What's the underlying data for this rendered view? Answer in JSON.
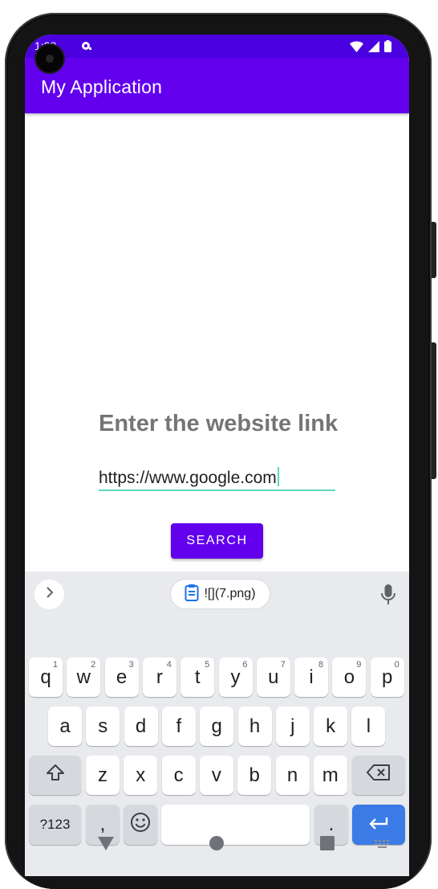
{
  "status_bar": {
    "time": "1:38"
  },
  "app_bar": {
    "title": "My Application"
  },
  "main": {
    "heading": "Enter the website link",
    "url_input_value": "https://www.google.com",
    "search_button_label": "SEARCH"
  },
  "keyboard": {
    "clipboard_chip": "![](7.png)",
    "row1": [
      {
        "key": "q",
        "hint": "1"
      },
      {
        "key": "w",
        "hint": "2"
      },
      {
        "key": "e",
        "hint": "3"
      },
      {
        "key": "r",
        "hint": "4"
      },
      {
        "key": "t",
        "hint": "5"
      },
      {
        "key": "y",
        "hint": "6"
      },
      {
        "key": "u",
        "hint": "7"
      },
      {
        "key": "i",
        "hint": "8"
      },
      {
        "key": "o",
        "hint": "9"
      },
      {
        "key": "p",
        "hint": "0"
      }
    ],
    "row2": [
      "a",
      "s",
      "d",
      "f",
      "g",
      "h",
      "j",
      "k",
      "l"
    ],
    "row3": [
      "z",
      "x",
      "c",
      "v",
      "b",
      "n",
      "m"
    ],
    "symbols_key": "?123",
    "comma_key": ",",
    "period_key": "."
  },
  "colors": {
    "status_bar": "#4b00e0",
    "app_bar": "#6200ee",
    "accent": "#5fd6c0",
    "enter_key": "#3b7be6"
  },
  "icons": {
    "status": [
      "notification-icon",
      "wifi-icon",
      "signal-icon",
      "battery-icon"
    ],
    "keyboard": [
      "chevron-right-icon",
      "clipboard-icon",
      "mic-icon",
      "shift-icon",
      "backspace-icon",
      "emoji-icon",
      "enter-icon"
    ],
    "nav": [
      "back-icon",
      "home-icon",
      "recents-icon",
      "keyboard-switch-icon"
    ]
  }
}
